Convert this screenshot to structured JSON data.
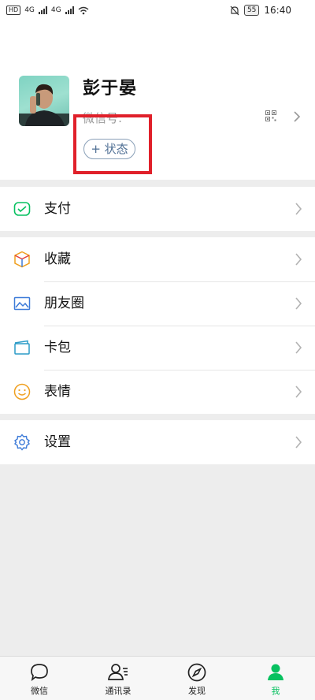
{
  "status_bar": {
    "hd_label": "HD",
    "network_1": "4G",
    "network_2": "4G",
    "battery": "55",
    "time": "16:40"
  },
  "profile": {
    "name": "彭于晏",
    "wechat_id_label": "微信号:",
    "status_button": "+ 状态"
  },
  "menu": {
    "pay": "支付",
    "favorites": "收藏",
    "moments": "朋友圈",
    "cards": "卡包",
    "stickers": "表情",
    "settings": "设置"
  },
  "tabs": [
    {
      "label": "微信",
      "icon": "chat-bubble-icon"
    },
    {
      "label": "通讯录",
      "icon": "contacts-icon"
    },
    {
      "label": "发现",
      "icon": "compass-icon"
    },
    {
      "label": "我",
      "icon": "person-icon",
      "active": true
    }
  ],
  "colors": {
    "accent": "#07c160",
    "highlight_box": "#e0202a",
    "status_button": "#4f6f94"
  }
}
